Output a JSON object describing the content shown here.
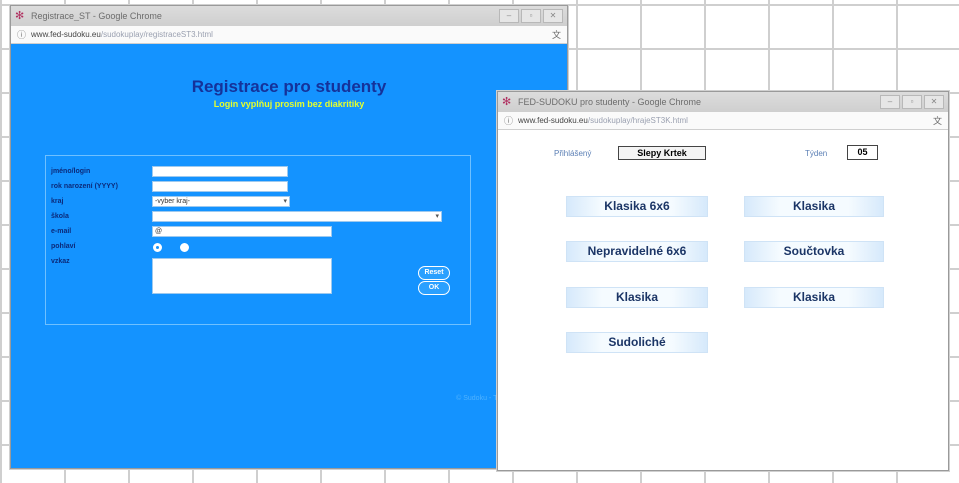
{
  "window1": {
    "title": "Registrace_ST - Google Chrome",
    "address_host": "www.fed-sudoku.eu",
    "address_path": "/sudokuplay/registraceST3.html",
    "heading": "Registrace pro studenty",
    "subheading": "Login vyplňuj prosím bez diakritiky",
    "form": {
      "fields": [
        {
          "label": "jméno/login",
          "value": ""
        },
        {
          "label": "rok narození (YYYY)",
          "value": ""
        },
        {
          "label": "kraj",
          "value": "-vyber kraj-"
        },
        {
          "label": "škola",
          "value": ""
        },
        {
          "label": "e-mail",
          "value": "@"
        },
        {
          "label": "pohlaví",
          "value": ""
        },
        {
          "label": "vzkaz",
          "value": ""
        }
      ],
      "reset_label": "Reset",
      "ok_label": "OK"
    },
    "footer": "© Sudoku - Tomáš , 2016-2020"
  },
  "window2": {
    "title": "FED-SUDOKU pro studenty - Google Chrome",
    "address_host": "www.fed-sudoku.eu",
    "address_path": "/sudokuplay/hrajeST3K.html",
    "login_label": "Přihlášený",
    "login_value": "Slepy Krtek",
    "week_label": "Týden",
    "week_value": "05",
    "games": [
      "Klasika 6x6",
      "Klasika",
      "Nepravidelné 6x6",
      "Součtovka",
      "Klasika",
      "Klasika",
      "Sudoliché"
    ]
  },
  "colors": {
    "form_background": "#1493ff",
    "heading": "#15329a",
    "subheading": "#e5ff2e"
  }
}
